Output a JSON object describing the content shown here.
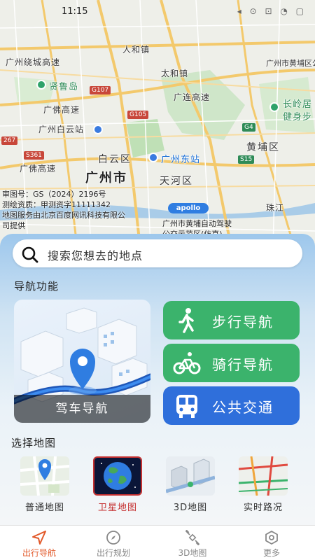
{
  "status": {
    "time": "11:15",
    "icons": "◂ ⊙ ⊡ ◔ ▢"
  },
  "map": {
    "labels": {
      "guangzhou_ring": "广州绕城高速",
      "renhe": "人和镇",
      "xianlu_island": "贤鲁岛",
      "taihe": "太和镇",
      "guangfo_expressway": "广佛高速",
      "guangzhou_baiyun_station": "广州白云站",
      "guanglian_expressway": "广连高速",
      "huangpu_public": "广州市黄埔区公交示范区",
      "changling": "长岭居",
      "health_step": "健身步",
      "huangpu_district": "黄埔区",
      "baiyun_district": "白云区",
      "guangzhou_east": "广州东站",
      "guangfo_road": "广佛高速",
      "guangzhou_city": "广州市",
      "tianhe_district": "天河区",
      "zhujiang": "珠江"
    },
    "road_badges": {
      "g107": "G107",
      "g105": "G105",
      "s267": "267",
      "s361": "S361",
      "s15": "S15",
      "g4": "G4"
    },
    "apollo": "apollo",
    "copyright_lines": [
      "审图号：GS（2024）2196号",
      "测绘资质：甲测资字11111342",
      "地图服务由北京百度网讯科技有限公",
      "司提供"
    ],
    "bottom_label_lines": [
      "广州市黄埔自动驾驶",
      "公交示范区(仿真)"
    ]
  },
  "search": {
    "placeholder": "搜索您想去的地点"
  },
  "nav_section": {
    "title": "导航功能",
    "drive": "驾车导航",
    "walk": "步行导航",
    "bike": "骑行导航",
    "bus": "公共交通"
  },
  "map_select": {
    "title": "选择地图",
    "options": [
      "普通地图",
      "卫星地图",
      "3D地图",
      "实时路况"
    ],
    "selected": "卫星地图"
  },
  "tabs": [
    "出行导航",
    "出行规划",
    "3D地图",
    "更多"
  ],
  "colors": {
    "green_button": "#3bb36c",
    "blue_button": "#2f6fdb",
    "active_tab": "#e25a2b",
    "selected_map": "#c53030"
  }
}
